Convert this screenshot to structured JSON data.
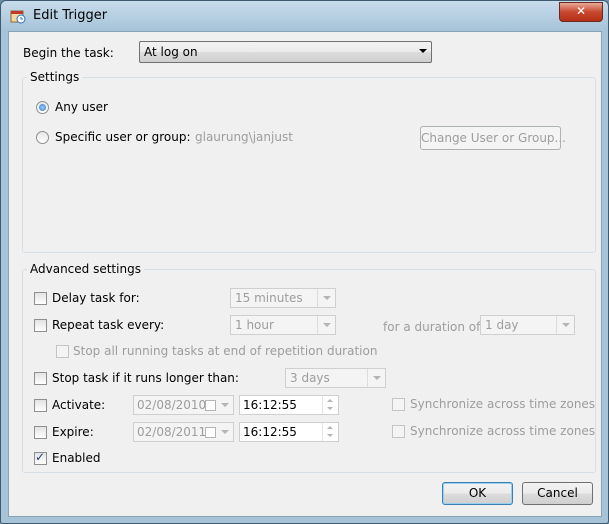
{
  "window": {
    "title": "Edit Trigger",
    "close_glyph": "✕"
  },
  "begin_task": {
    "label": "Begin the task:",
    "selected": "At log on"
  },
  "settings": {
    "title": "Settings",
    "any_user_label": "Any user",
    "any_user_selected": true,
    "specific_user_label": "Specific user or group:",
    "specific_user_selected": false,
    "user_value": "glaurung\\janjust",
    "change_button": "Change User or Group..."
  },
  "advanced": {
    "title": "Advanced settings",
    "delay": {
      "label": "Delay task for:",
      "checked": false,
      "value": "15 minutes"
    },
    "repeat": {
      "label": "Repeat task every:",
      "checked": false,
      "value": "1 hour",
      "duration_label": "for a duration of:",
      "duration_value": "1 day"
    },
    "stop_running": {
      "label": "Stop all running tasks at end of repetition duration",
      "checked": false
    },
    "stop_longer": {
      "label": "Stop task if it runs longer than:",
      "checked": false,
      "value": "3 days"
    },
    "activate": {
      "label": "Activate:",
      "checked": false,
      "date": "02/08/2010",
      "time": "16:12:55",
      "sync_label": "Synchronize across time zones",
      "sync_checked": false
    },
    "expire": {
      "label": "Expire:",
      "checked": false,
      "date": "02/08/2011",
      "time": "16:12:55",
      "sync_label": "Synchronize across time zones",
      "sync_checked": false
    },
    "enabled": {
      "label": "Enabled",
      "checked": true
    }
  },
  "buttons": {
    "ok": "OK",
    "cancel": "Cancel"
  }
}
